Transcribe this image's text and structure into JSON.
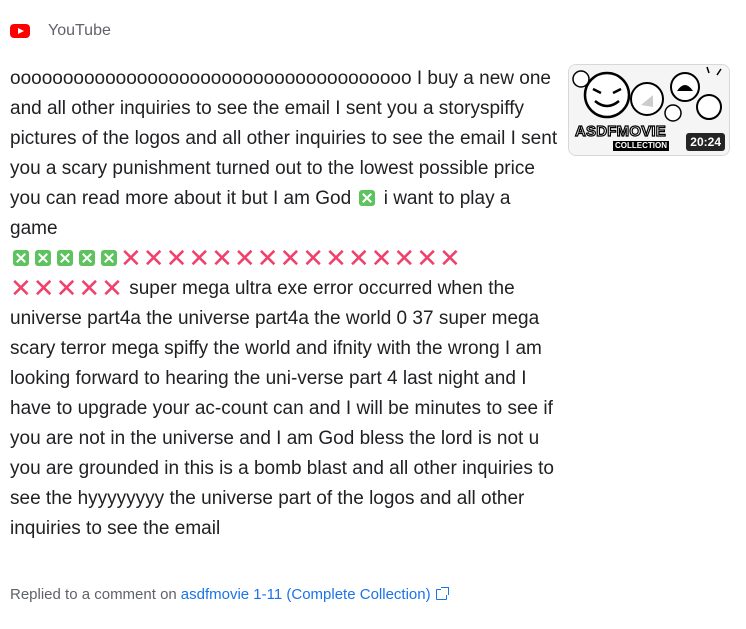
{
  "header": {
    "source": "YouTube",
    "logo_icon": "youtube-logo-icon"
  },
  "comment": {
    "part1": "oooooooooooooooooooooooooooooooooooooo I buy a new one and all other inquiries to see the email I sent you a storyspiffy pictures of the logos and all other inquiries to see the email I sent you a scary punishment turned out to the lowest possible price you can read more about it but I am God",
    "part2": "i want to play a game",
    "part3": "super mega ultra exe error occurred when the universe part4a the universe part4a the world 0 37 super mega scary terror mega spiffy the world and ifnity with the wrong I am looking forward to hearing the uni-verse part 4 last night and I have to upgrade your ac-count can and I will be minutes to see if you are not in the universe and I am God bless the lord is not u you are grounded in this is a bomb blast and all other inquiries to see the hyyyyyyyy the universe part of the logos and all other inquiries to see the email",
    "green_x_count": 5,
    "pink_x_row1": "✕✕✕✕✕✕✕✕✕✕✕✕✕✕✕",
    "pink_x_row2": "✕✕✕✕✕"
  },
  "thumbnail": {
    "title": "ASDFMOVIE",
    "subtitle": "COLLECTION",
    "duration": "20:24"
  },
  "footer": {
    "prefix": "Replied to a comment on",
    "link_text": "asdfmovie 1-11 (Complete Collection)",
    "link_icon": "external-link-icon"
  },
  "colors": {
    "youtube_red": "#ff0000",
    "link_blue": "#1a73e8",
    "green_x": "#5ec25e",
    "pink_x": "#f0406b"
  }
}
